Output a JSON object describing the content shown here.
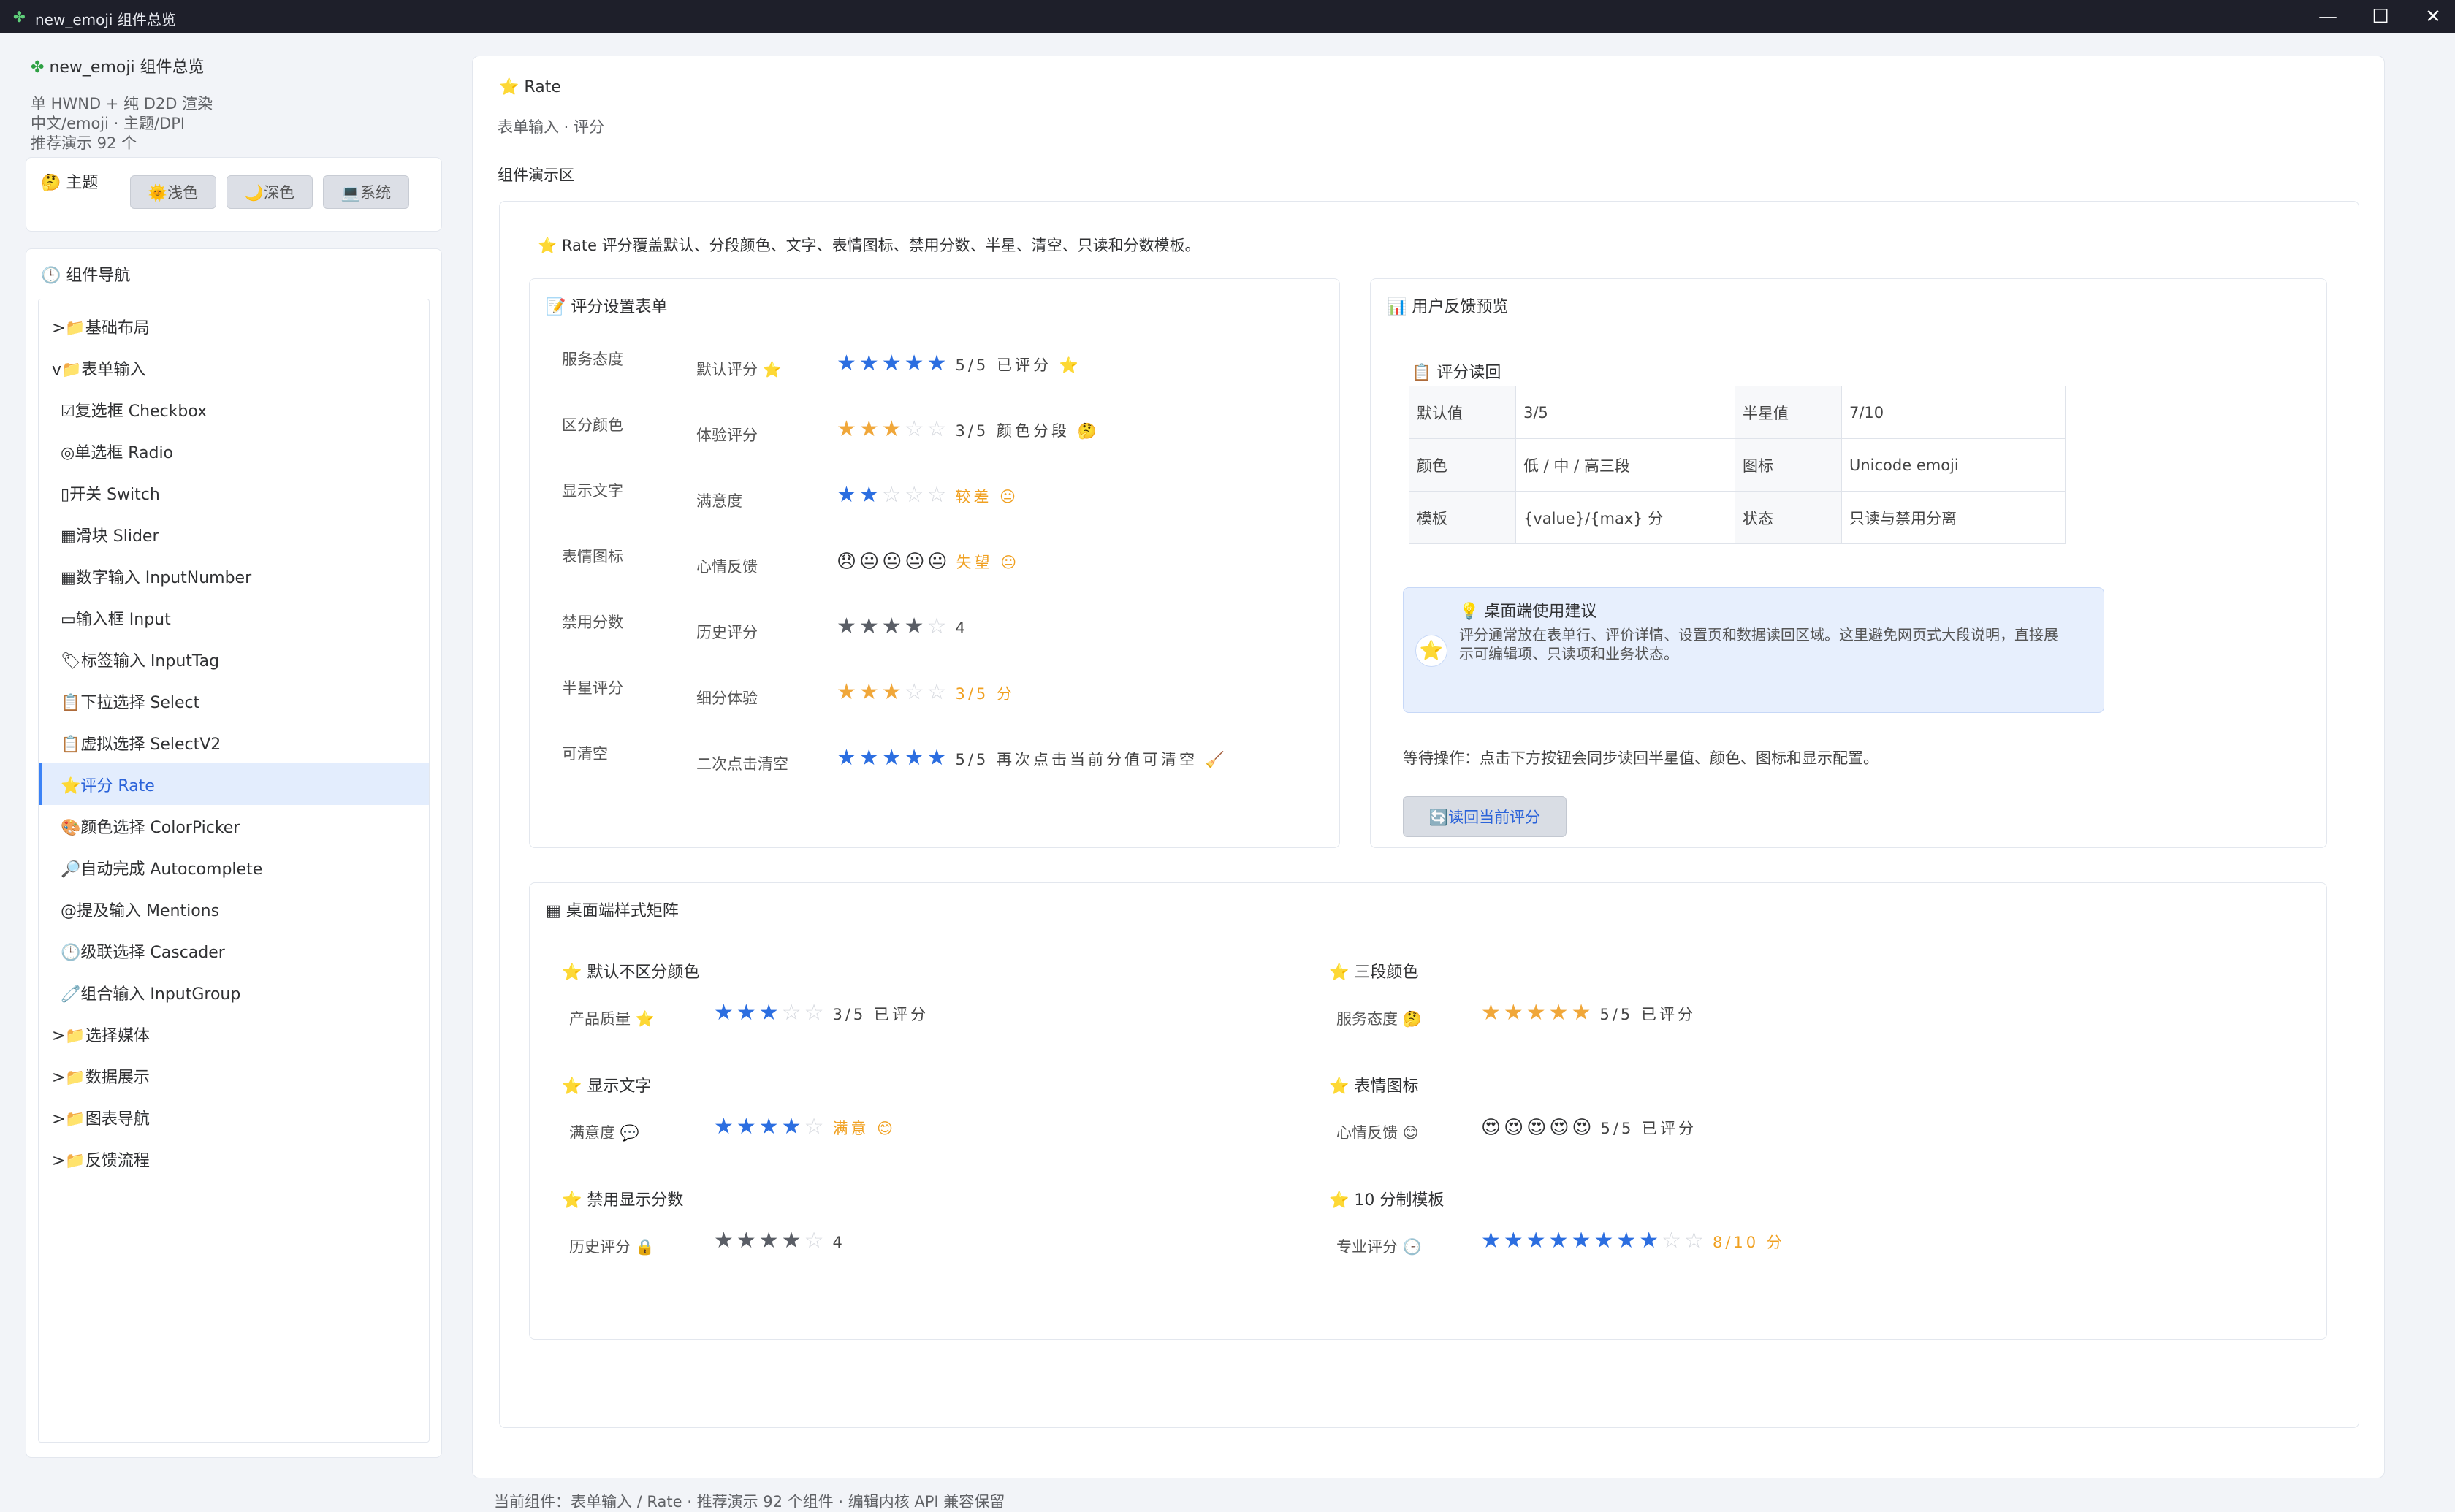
{
  "window": {
    "title": "new_emoji 组件总览",
    "btn_min": "—",
    "btn_max": "☐",
    "btn_close": "✕"
  },
  "sidebar": {
    "app_title": "new_emoji 组件总览",
    "line1": "单 HWND + 纯 D2D 渲染",
    "line2": "中文/emoji · 主题/DPI",
    "line3": "推荐演示 92 个",
    "theme_title": "主题",
    "theme_light": "🌞浅色",
    "theme_dark": "🌙深色",
    "theme_system": "💻系统",
    "nav_title": "组件导航",
    "nav": [
      {
        "label": ">📁基础布局"
      },
      {
        "label": "v📁表单输入"
      },
      {
        "label": "☑复选框 Checkbox"
      },
      {
        "label": "◎单选框 Radio"
      },
      {
        "label": "▯开关 Switch"
      },
      {
        "label": "▦滑块 Slider"
      },
      {
        "label": "▦数字输入 InputNumber"
      },
      {
        "label": "▭输入框 Input"
      },
      {
        "label": "🏷标签输入 InputTag"
      },
      {
        "label": "📋下拉选择 Select"
      },
      {
        "label": "📋虚拟选择 SelectV2"
      },
      {
        "label": "⭐评分 Rate"
      },
      {
        "label": "🎨颜色选择 ColorPicker"
      },
      {
        "label": "🔎自动完成 Autocomplete"
      },
      {
        "label": "@提及输入 Mentions"
      },
      {
        "label": "🕒级联选择 Cascader"
      },
      {
        "label": "🧷组合输入 InputGroup"
      },
      {
        "label": ">📁选择媒体"
      },
      {
        "label": ">📁数据展示"
      },
      {
        "label": ">📁图表导航"
      },
      {
        "label": ">📁反馈流程"
      }
    ]
  },
  "main": {
    "title": "Rate",
    "subtitle": "表单输入 · 评分",
    "demo_title": "组件演示区",
    "intro": "Rate 评分覆盖默认、分段颜色、文字、表情图标、禁用分数、半星、清空、只读和分数模板。",
    "form": {
      "title": "评分设置表单",
      "rows": [
        {
          "left": "服务态度",
          "label": "默认评分 ⭐",
          "stars": "★★★★★",
          "empty": "",
          "text": "5/5 已评分 ⭐",
          "cls": "s-blue",
          "textcls": ""
        },
        {
          "left": "区分颜色",
          "label": "体验评分",
          "stars": "★★★",
          "empty": "☆☆",
          "text": "3/5 颜色分段 🤔",
          "cls": "s-gold",
          "textcls": ""
        },
        {
          "left": "显示文字",
          "label": "满意度",
          "stars": "★★",
          "empty": "☆☆☆",
          "text": "较差 😐",
          "cls": "s-blue",
          "textcls": "warn"
        },
        {
          "left": "表情图标",
          "label": "心情反馈",
          "stars": "😞😐😐😐😐",
          "empty": "",
          "text": "失望 😐",
          "cls": "emo",
          "textcls": "warn"
        },
        {
          "left": "禁用分数",
          "label": "历史评分",
          "stars": "★★★★",
          "empty": "☆",
          "text": "4",
          "cls": "s-gray",
          "textcls": ""
        },
        {
          "left": "半星评分",
          "label": "细分体验",
          "stars": "★★★",
          "empty": "☆☆",
          "text": "3/5 分",
          "cls": "s-gold",
          "textcls": "warn"
        },
        {
          "left": "可清空",
          "label": "二次点击清空",
          "stars": "★★★★★",
          "empty": "",
          "text": "5/5 再次点击当前分值可清空 🧹",
          "cls": "s-blue",
          "textcls": ""
        }
      ]
    },
    "feedback": {
      "title": "用户反馈预览",
      "readout_title": "评分读回",
      "table": [
        [
          "默认值",
          "3/5",
          "半星值",
          "7/10"
        ],
        [
          "颜色",
          "低 / 中 / 高三段",
          "图标",
          "Unicode emoji"
        ],
        [
          "模板",
          "{value}/{max} 分",
          "状态",
          "只读与禁用分离"
        ]
      ],
      "tip_title": "桌面端使用建议",
      "tip_text1": "评分通常放在表单行、评价详情、设置页和数据读回区域。这里避免网页式大段说明，直接展",
      "tip_text2": "示可编辑项、只读项和业务状态。",
      "wait_text": "等待操作：点击下方按钮会同步读回半星值、颜色、图标和显示配置。",
      "read_button": "🔄读回当前评分"
    },
    "matrix": {
      "title": "桌面端样式矩阵",
      "items": [
        {
          "head": "默认不区分颜色",
          "label": "产品质量 ⭐",
          "stars": "★★★",
          "empty": "☆☆",
          "text": "3/5 已评分",
          "cls": "s-blue",
          "textcls": ""
        },
        {
          "head": "三段颜色",
          "label": "服务态度 🤔",
          "stars": "★★★★★",
          "empty": "",
          "text": "5/5 已评分",
          "cls": "s-gold",
          "textcls": ""
        },
        {
          "head": "显示文字",
          "label": "满意度 💬",
          "stars": "★★★★",
          "empty": "☆",
          "text": "满意 😊",
          "cls": "s-blue",
          "textcls": "warn"
        },
        {
          "head": "表情图标",
          "label": "心情反馈 😊",
          "stars": "😍😍😍😍😍",
          "empty": "",
          "text": "5/5 已评分",
          "cls": "emo",
          "textcls": ""
        },
        {
          "head": "禁用显示分数",
          "label": "历史评分 🔒",
          "stars": "★★★★",
          "empty": "☆",
          "text": "4",
          "cls": "s-gray",
          "textcls": ""
        },
        {
          "head": "10 分制模板",
          "label": "专业评分 🕒",
          "stars": "★★★★★★★★",
          "empty": "☆☆",
          "text": "8/10 分",
          "cls": "s-blue",
          "textcls": "warn"
        }
      ]
    }
  },
  "status_bar": "当前组件：表单输入 / Rate · 推荐演示 92 个组件 · 编辑内核 API 兼容保留"
}
